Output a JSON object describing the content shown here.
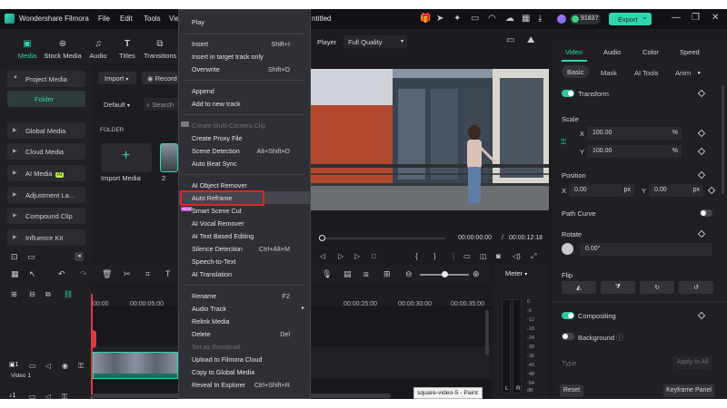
{
  "app": {
    "name": "Wondershare Filmora",
    "menus": [
      "File",
      "Edit",
      "Tools",
      "Vie"
    ],
    "project_title": "ntitled",
    "credits": "91837",
    "export_label": "Export",
    "export_caret": "⌄"
  },
  "toolbar": {
    "items": [
      {
        "label": "Media",
        "icon": "media-icon"
      },
      {
        "label": "Stock Media",
        "icon": "stock-media-icon"
      },
      {
        "label": "Audio",
        "icon": "audio-icon"
      },
      {
        "label": "Titles",
        "icon": "titles-icon"
      },
      {
        "label": "Transitions",
        "icon": "transitions-icon"
      }
    ]
  },
  "left_panel": {
    "items": [
      "Project Media",
      "Global Media",
      "Cloud Media",
      "AI Media",
      "Adjustment La...",
      "Compound Clip",
      "Influence Kit"
    ],
    "folder_label": "Folder",
    "ai_badge": "AI"
  },
  "media_area": {
    "import_label": "Import",
    "record_label": "Record",
    "sort_label": "Default",
    "search_placeholder": "Search",
    "folder_header": "FOLDER",
    "import_media_label": "Import Media",
    "clip_count": "2"
  },
  "player": {
    "label": "Player",
    "quality": "Full Quality",
    "current_time": "00:00:00:00",
    "separator": "/",
    "total_time": "00:00:12:18"
  },
  "context_menu": {
    "items": [
      {
        "label": "Play",
        "shortcut": ""
      },
      {
        "label": "Insert",
        "shortcut": "Shift+I"
      },
      {
        "label": "Insert in target track only",
        "shortcut": ""
      },
      {
        "label": "Overwrite",
        "shortcut": "Shift+O"
      },
      {
        "label": "Append",
        "shortcut": ""
      },
      {
        "label": "Add to new track",
        "shortcut": ""
      },
      {
        "label": "Create Multi-Camera Clip",
        "shortcut": ""
      },
      {
        "label": "Create Proxy File",
        "shortcut": ""
      },
      {
        "label": "Scene Detection",
        "shortcut": "Alt+Shift+D"
      },
      {
        "label": "Auto Beat Sync",
        "shortcut": ""
      },
      {
        "label": "AI Object Remover",
        "shortcut": ""
      },
      {
        "label": "Auto Reframe",
        "shortcut": ""
      },
      {
        "label": "Smart Scene Cut",
        "shortcut": ""
      },
      {
        "label": "AI Vocal Remover",
        "shortcut": ""
      },
      {
        "label": "AI Text Based Editing",
        "shortcut": ""
      },
      {
        "label": "Silence Detection",
        "shortcut": "Ctrl+Alt+M"
      },
      {
        "label": "Speech-to-Text",
        "shortcut": ""
      },
      {
        "label": "AI Translation",
        "shortcut": ""
      },
      {
        "label": "Rename",
        "shortcut": "F2"
      },
      {
        "label": "Audio Track",
        "shortcut": ""
      },
      {
        "label": "Relink Media",
        "shortcut": ""
      },
      {
        "label": "Delete",
        "shortcut": "Del"
      },
      {
        "label": "Set as thumbnail",
        "shortcut": ""
      },
      {
        "label": "Upload to Filmora Cloud",
        "shortcut": ""
      },
      {
        "label": "Copy to Global Media",
        "shortcut": ""
      },
      {
        "label": "Reveal In Explorer",
        "shortcut": "Ctrl+Shift+R"
      }
    ],
    "new_badge": "NEW",
    "submenu_arrow": "▸"
  },
  "timeline": {
    "ruler": [
      "00:00",
      "00:00:05:00",
      "00:00:25:00",
      "00:00:30:00",
      "00:00:35:00"
    ],
    "track_video_label": "Video 1",
    "track_video_num": "1",
    "track_audio_num": "1",
    "meter_label": "Meter",
    "meter_scale": [
      "0",
      "-6",
      "-12",
      "-18",
      "-24",
      "-30",
      "-36",
      "-42",
      "-48",
      "-54",
      "dB"
    ],
    "lr": [
      "L",
      "R"
    ],
    "tooltip": "square-video-5 - Paint"
  },
  "right_panel": {
    "tabs": [
      "Video",
      "Audio",
      "Color",
      "Speed"
    ],
    "subtabs": [
      "Basic",
      "Mask",
      "AI Tools",
      "Anim"
    ],
    "transform_label": "Transform",
    "scale_label": "Scale",
    "x_label": "X",
    "y_label": "Y",
    "scale_x": "100.00",
    "scale_y": "100.00",
    "percent": "%",
    "position_label": "Position",
    "pos_x": "0.00",
    "pos_y": "0.00",
    "px_unit": "px",
    "path_curve_label": "Path Curve",
    "rotate_label": "Rotate",
    "rotate_value": "0.00°",
    "flip_label": "Flip",
    "compositing_label": "Compositing",
    "background_label": "Background",
    "type_label": "Type",
    "apply_all_label": "Apply to All",
    "reset_label": "Reset",
    "keyframe_label": "Keyframe Panel"
  }
}
